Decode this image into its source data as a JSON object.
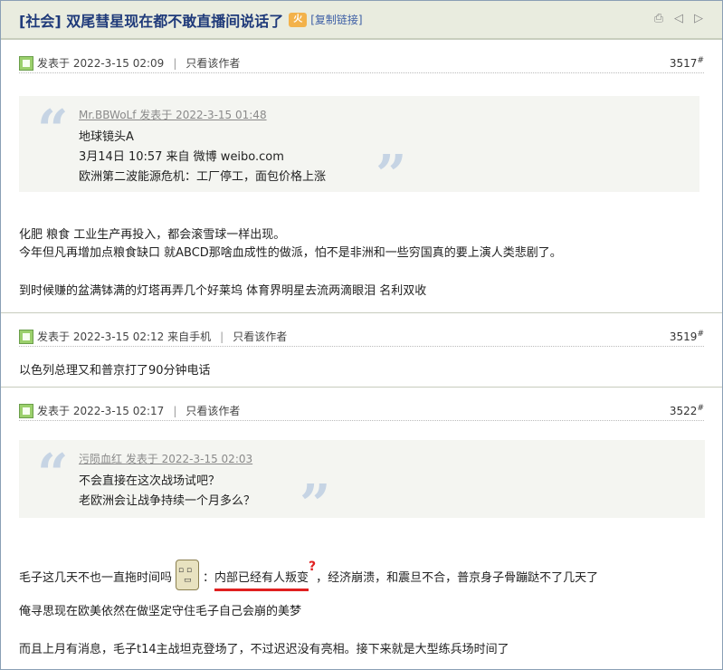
{
  "thread": {
    "title": "[社会] 双尾彗星现在都不敢直播间说话了",
    "hot_badge": "火",
    "copy_link": "[复制链接]",
    "tools": [
      "print-icon",
      "prev-icon",
      "next-icon"
    ]
  },
  "posts": [
    {
      "posted": "发表于 2022-3-15 02:09",
      "only_author": "只看该作者",
      "floor": "3517",
      "floor_mark": "#",
      "quote": {
        "author": "Mr.BBWoLf 发表于 2022-3-15 01:48",
        "lines": [
          "地球镜头A",
          "3月14日 10:57 来自 微博 weibo.com",
          "欧洲第二波能源危机：工厂停工，面包价格上涨"
        ]
      },
      "body": [
        "化肥 粮食 工业生产再投入，都会滚雪球一样出现。",
        "今年但凡再增加点粮食缺口 就ABCD那啥血成性的做派，怕不是非洲和一些穷国真的要上演人类悲剧了。",
        "到时候赚的盆满钵满的灯塔再弄几个好莱坞 体育界明星去流两滴眼泪 名利双收"
      ]
    },
    {
      "posted": "发表于 2022-3-15 02:12 来自手机",
      "only_author": "只看该作者",
      "floor": "3519",
      "floor_mark": "#",
      "body": [
        "以色列总理又和普京打了90分钟电话"
      ]
    },
    {
      "posted": "发表于 2022-3-15 02:17",
      "only_author": "只看该作者",
      "floor": "3522",
      "floor_mark": "#",
      "quote": {
        "author": "污陨血红 发表于 2022-3-15 02:03",
        "lines": [
          "不会直接在这次战场试吧？",
          "老欧洲会让战争持续一个月多么？"
        ]
      },
      "body_first": {
        "before": "毛子这几天不也一直拖时间吗",
        "colon": "：",
        "highlight": "内部已经有人叛变",
        "question": "?",
        "after": "，经济崩溃，和震旦不合，普京身子骨蹦跶不了几天了"
      },
      "body": [
        "俺寻思现在欧美依然在做坚定守住毛子自己会崩的美梦",
        "而且上月有消息，毛子t14主战坦克登场了，不过迟迟没有亮相。接下来就是大型练兵场时间了"
      ]
    }
  ]
}
